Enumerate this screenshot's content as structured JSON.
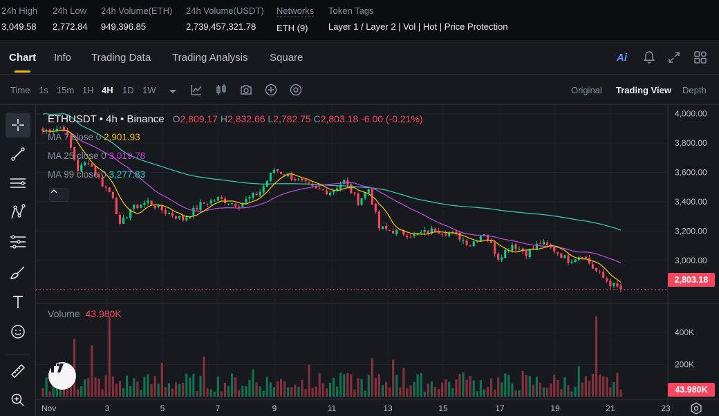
{
  "stats": [
    {
      "label": "24h High",
      "value": "3,049.58"
    },
    {
      "label": "24h Low",
      "value": "2,772.84"
    },
    {
      "label": "24h Volume(ETH)",
      "value": "949,396.85"
    },
    {
      "label": "24h Volume(USDT)",
      "value": "2,739,457,321.78"
    },
    {
      "label": "Networks",
      "value": "ETH (9)"
    },
    {
      "label": "Token Tags",
      "tags": [
        "Layer 1 / Layer 2",
        "Vol",
        "Hot",
        "Price Protection"
      ],
      "separator": " | "
    }
  ],
  "tabs": [
    "Chart",
    "Info",
    "Trading Data",
    "Trading Analysis",
    "Square"
  ],
  "active_tab": "Chart",
  "tab_icons": [
    "ai-icon",
    "bell-icon",
    "expand-icon",
    "layout-grid-icon"
  ],
  "ai_label": "Ai",
  "intervals": {
    "label": "Time",
    "options": [
      "1s",
      "15m",
      "1H",
      "4H",
      "1D",
      "1W"
    ],
    "active": "4H"
  },
  "view_modes": [
    "Original",
    "Trading View",
    "Depth"
  ],
  "active_view": "Trading View",
  "legend": {
    "symbol": "ETHUSDT",
    "interval": "4h",
    "exchange": "Binance",
    "open_key": "O",
    "open": "2,809.17",
    "high_key": "H",
    "high": "2,832.66",
    "low_key": "L",
    "low": "2,782.75",
    "close_key": "C",
    "close": "2,803.18",
    "change": "-6.00 (-0.21%)",
    "ma": [
      {
        "label": "MA 7 close 0",
        "value": "2,901.93",
        "color": "#f0b90b"
      },
      {
        "label": "MA 25 close 0",
        "value": "3,019.78",
        "color": "#cb3fd8"
      },
      {
        "label": "MA 99 close 0",
        "value": "3,277.83",
        "color": "#2fd6c6"
      }
    ],
    "volume_label": "Volume",
    "volume_value": "43.980K"
  },
  "colors": {
    "up": "#0ecb81",
    "down": "#f6465d",
    "ma7": "#f0b90b",
    "ma25": "#b84ad1",
    "ma99": "#3bbfb3",
    "accent": "#f0b90b"
  },
  "chart_data": {
    "type": "candlestick",
    "price_axis_ticks": [
      "4,000.00",
      "3,800.00",
      "3,600.00",
      "3,400.00",
      "3,200.00",
      "3,000.00"
    ],
    "price_axis_values": [
      4000,
      3800,
      3600,
      3400,
      3200,
      3000
    ],
    "volume_axis_ticks": [
      "400K",
      "200K"
    ],
    "volume_axis_values": [
      400000,
      200000
    ],
    "last_price_label": "2,803.18",
    "last_price": 2803.18,
    "last_volume_label": "43.980K",
    "last_volume": 43980,
    "x_ticks": [
      "Nov",
      "3",
      "5",
      "7",
      "9",
      "11",
      "13",
      "15",
      "17",
      "19",
      "21",
      "23"
    ],
    "ylim": [
      2730,
      4060
    ],
    "vol_ylim": [
      0,
      560000
    ],
    "anchor_closes": [
      [
        0,
        3880
      ],
      [
        6,
        3910
      ],
      [
        10,
        3620
      ],
      [
        13,
        3680
      ],
      [
        17,
        3520
      ],
      [
        20,
        3440
      ],
      [
        22,
        3230
      ],
      [
        25,
        3350
      ],
      [
        30,
        3400
      ],
      [
        35,
        3330
      ],
      [
        40,
        3280
      ],
      [
        45,
        3380
      ],
      [
        50,
        3420
      ],
      [
        56,
        3380
      ],
      [
        62,
        3470
      ],
      [
        66,
        3620
      ],
      [
        70,
        3580
      ],
      [
        74,
        3530
      ],
      [
        78,
        3480
      ],
      [
        82,
        3470
      ],
      [
        86,
        3540
      ],
      [
        90,
        3400
      ],
      [
        93,
        3490
      ],
      [
        96,
        3220
      ],
      [
        100,
        3200
      ],
      [
        106,
        3170
      ],
      [
        112,
        3210
      ],
      [
        118,
        3170
      ],
      [
        122,
        3110
      ],
      [
        126,
        3190
      ],
      [
        130,
        3020
      ],
      [
        134,
        3110
      ],
      [
        138,
        3050
      ],
      [
        142,
        3120
      ],
      [
        146,
        3070
      ],
      [
        150,
        3000
      ],
      [
        154,
        3040
      ],
      [
        157,
        2950
      ],
      [
        160,
        2880
      ],
      [
        162,
        2840
      ],
      [
        165,
        2803.18
      ]
    ],
    "volume_spikes": [
      [
        9,
        360000
      ],
      [
        14,
        320000
      ],
      [
        19,
        500000
      ],
      [
        34,
        210000
      ],
      [
        46,
        250000
      ],
      [
        60,
        170000
      ],
      [
        76,
        200000
      ],
      [
        86,
        140000
      ],
      [
        94,
        240000
      ],
      [
        100,
        230000
      ],
      [
        103,
        180000
      ],
      [
        120,
        150000
      ],
      [
        137,
        160000
      ],
      [
        153,
        190000
      ],
      [
        158,
        500000
      ]
    ],
    "series": [
      {
        "name": "MA 7 close 0"
      },
      {
        "name": "MA 25 close 0"
      },
      {
        "name": "MA 99 close 0"
      }
    ]
  }
}
